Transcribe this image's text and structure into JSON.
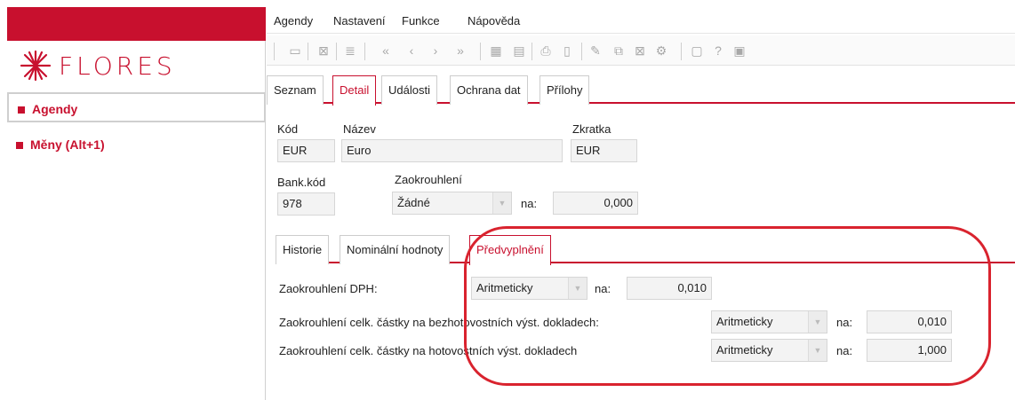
{
  "app": {
    "brand": "FLORES",
    "accent": "#c8102e"
  },
  "sidebar": {
    "items": [
      {
        "label": "Agendy"
      },
      {
        "label": "Měny (Alt+1)"
      }
    ]
  },
  "menubar": {
    "items": [
      "Agendy",
      "Nastavení",
      "Funkce",
      "Nápověda"
    ]
  },
  "toolbar": {
    "icons": [
      "open-folder-icon",
      "close-icon",
      "list-icon",
      "first-icon",
      "prev-icon",
      "next-icon",
      "last-icon",
      "grid-icon",
      "record-icon",
      "print-icon",
      "page-icon",
      "edit-icon",
      "copy-icon",
      "delete-icon",
      "settings-icon",
      "info-icon",
      "help-icon",
      "message-icon"
    ]
  },
  "tabs": [
    {
      "label": "Seznam"
    },
    {
      "label": "Detail"
    },
    {
      "label": "Události"
    },
    {
      "label": "Ochrana dat"
    },
    {
      "label": "Přílohy"
    }
  ],
  "form": {
    "kod_label": "Kód",
    "kod_value": "EUR",
    "nazev_label": "Název",
    "nazev_value": "Euro",
    "zkratka_label": "Zkratka",
    "zkratka_value": "EUR",
    "bank_label": "Bank.kód",
    "bank_value": "978",
    "zaokr_label": "Zaokrouhlení",
    "zaokr_value": "Žádné",
    "na_label": "na:",
    "na_value": "0,000"
  },
  "subtabs": [
    {
      "label": "Historie"
    },
    {
      "label": "Nominální hodnoty"
    },
    {
      "label": "Předvyplnění"
    }
  ],
  "prefill": {
    "rows": [
      {
        "label": "Zaokrouhlení DPH:",
        "mode": "Aritmeticky",
        "na": "na:",
        "value": "0,010"
      },
      {
        "label": "Zaokrouhlení celk. částky na bezhotovostních výst. dokladech:",
        "mode": "Aritmeticky",
        "na": "na:",
        "value": "0,010"
      },
      {
        "label": "Zaokrouhlení celk. částky na hotovostních výst. dokladech",
        "mode": "Aritmeticky",
        "na": "na:",
        "value": "1,000"
      }
    ]
  }
}
